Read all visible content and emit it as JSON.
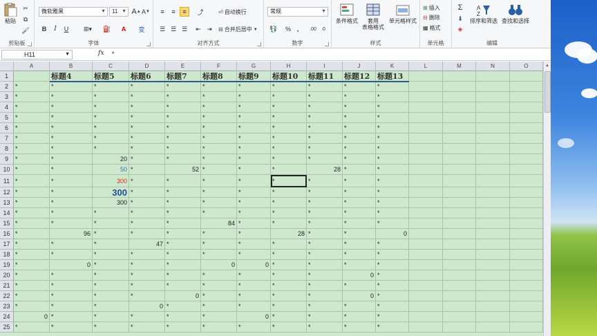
{
  "ribbon": {
    "clipboard": {
      "paste": "粘贴",
      "label": "剪贴板"
    },
    "font": {
      "name": "微软雅黑",
      "size": "11",
      "bold": "B",
      "italic": "I",
      "underline": "U",
      "wen": "变",
      "label": "字体",
      "grow": "A",
      "shrink": "A"
    },
    "alignment": {
      "wrap": "自动换行",
      "merge": "合并后居中",
      "label": "对齐方式"
    },
    "number": {
      "format": "常规",
      "percent": "%",
      "comma": ",",
      "label": "数字"
    },
    "styles": {
      "conditional": "条件格式",
      "table1": "套用",
      "table2": "表格格式",
      "cell_styles": "单元格样式",
      "label": "样式"
    },
    "cells": {
      "insert": "插入",
      "delete": "删除",
      "format": "格式",
      "label": "单元格"
    },
    "editing": {
      "sigma": "Σ",
      "sort": "排序和筛选",
      "find": "查找和选择",
      "label": "编辑"
    }
  },
  "formula_bar": {
    "name_box": "H11",
    "fx": "fx",
    "content": "*"
  },
  "columns": [
    "A",
    "B",
    "C",
    "D",
    "E",
    "F",
    "G",
    "H",
    "I",
    "J",
    "K",
    "L",
    "M",
    "N",
    "O"
  ],
  "rows": [
    {
      "n": "1",
      "cells": [
        "",
        "标题4",
        "标题5",
        "标题6",
        "标题7",
        "标题8",
        "标题9",
        "标题10",
        "标题11",
        "标题12",
        "标题13",
        "",
        "",
        "",
        ""
      ]
    },
    {
      "n": "2",
      "cells": [
        "*",
        "*",
        "*",
        "*",
        "*",
        "*",
        "*",
        "*",
        "*",
        "*",
        "*",
        "",
        "",
        "",
        ""
      ]
    },
    {
      "n": "3",
      "cells": [
        "*",
        "*",
        "*",
        "*",
        "*",
        "*",
        "*",
        "*",
        "*",
        "*",
        "*",
        "",
        "",
        "",
        ""
      ]
    },
    {
      "n": "4",
      "cells": [
        "*",
        "*",
        "*",
        "*",
        "*",
        "*",
        "*",
        "*",
        "*",
        "*",
        "*",
        "",
        "",
        "",
        ""
      ]
    },
    {
      "n": "5",
      "cells": [
        "*",
        "*",
        "*",
        "*",
        "*",
        "*",
        "*",
        "*",
        "*",
        "*",
        "*",
        "",
        "",
        "",
        ""
      ]
    },
    {
      "n": "6",
      "cells": [
        "*",
        "*",
        "*",
        "*",
        "*",
        "*",
        "*",
        "*",
        "*",
        "*",
        "*",
        "",
        "",
        "",
        ""
      ]
    },
    {
      "n": "7",
      "cells": [
        "*",
        "*",
        "*",
        "*",
        "*",
        "*",
        "*",
        "*",
        "*",
        "*",
        "*",
        "",
        "",
        "",
        ""
      ]
    },
    {
      "n": "8",
      "cells": [
        "*",
        "*",
        "*",
        "*",
        "*",
        "*",
        "*",
        "*",
        "*",
        "*",
        "*",
        "",
        "",
        "",
        ""
      ]
    },
    {
      "n": "9",
      "cells": [
        "*",
        "*",
        "20",
        "*",
        "*",
        "*",
        "*",
        "*",
        "*",
        "*",
        "*",
        "",
        "",
        "",
        ""
      ]
    },
    {
      "n": "10",
      "cells": [
        "*",
        "*",
        "50",
        "*",
        "52",
        "*",
        "*",
        "*",
        "28",
        "*",
        "*",
        "",
        "",
        "",
        ""
      ]
    },
    {
      "n": "11",
      "cells": [
        "*",
        "*",
        "300",
        "*",
        "*",
        "*",
        "*",
        "*",
        "*",
        "*",
        "*",
        "",
        "",
        "",
        ""
      ]
    },
    {
      "n": "12",
      "cells": [
        "*",
        "*",
        "300",
        "*",
        "*",
        "*",
        "*",
        "*",
        "*",
        "*",
        "*",
        "",
        "",
        "",
        ""
      ]
    },
    {
      "n": "13",
      "cells": [
        "*",
        "*",
        "300",
        "*",
        "*",
        "*",
        "*",
        "*",
        "*",
        "*",
        "*",
        "",
        "",
        "",
        ""
      ]
    },
    {
      "n": "14",
      "cells": [
        "*",
        "*",
        "*",
        "*",
        "*",
        "*",
        "*",
        "*",
        "*",
        "*",
        "*",
        "",
        "",
        "",
        ""
      ]
    },
    {
      "n": "15",
      "cells": [
        "*",
        "*",
        "*",
        "*",
        "*",
        "84",
        "*",
        "*",
        "*",
        "*",
        "*",
        "",
        "",
        "",
        ""
      ]
    },
    {
      "n": "16",
      "cells": [
        "*",
        "96",
        "*",
        "*",
        "*",
        "*",
        "*",
        "28",
        "*",
        "*",
        "0",
        "",
        "",
        "",
        ""
      ]
    },
    {
      "n": "17",
      "cells": [
        "*",
        "*",
        "*",
        "47",
        "*",
        "*",
        "*",
        "*",
        "*",
        "*",
        "*",
        "",
        "",
        "",
        ""
      ]
    },
    {
      "n": "18",
      "cells": [
        "*",
        "*",
        "*",
        "*",
        "*",
        "*",
        "*",
        "*",
        "*",
        "*",
        "*",
        "",
        "",
        "",
        ""
      ]
    },
    {
      "n": "19",
      "cells": [
        "*",
        "0",
        "*",
        "*",
        "*",
        "0",
        "0",
        "*",
        "*",
        "*",
        "*",
        "",
        "",
        "",
        ""
      ]
    },
    {
      "n": "20",
      "cells": [
        "*",
        "*",
        "*",
        "*",
        "*",
        "*",
        "*",
        "*",
        "*",
        "0",
        "*",
        "",
        "",
        "",
        ""
      ]
    },
    {
      "n": "21",
      "cells": [
        "*",
        "*",
        "*",
        "*",
        "*",
        "*",
        "*",
        "*",
        "*",
        "*",
        "*",
        "",
        "",
        "",
        ""
      ]
    },
    {
      "n": "22",
      "cells": [
        "*",
        "*",
        "*",
        "*",
        "0",
        "*",
        "*",
        "*",
        "*",
        "0",
        "*",
        "",
        "",
        "",
        ""
      ]
    },
    {
      "n": "23",
      "cells": [
        "*",
        "*",
        "*",
        "0",
        "*",
        "*",
        "*",
        "*",
        "*",
        "*",
        "*",
        "",
        "",
        "",
        ""
      ]
    },
    {
      "n": "24",
      "cells": [
        "0",
        "*",
        "*",
        "*",
        "*",
        "*",
        "0",
        "*",
        "*",
        "*",
        "*",
        "",
        "",
        "",
        ""
      ]
    },
    {
      "n": "25",
      "cells": [
        "*",
        "*",
        "*",
        "*",
        "*",
        "*",
        "*",
        "*",
        "*",
        "*",
        "*",
        "",
        "",
        "",
        ""
      ]
    }
  ],
  "styled_cells": {
    "9-2": "bl",
    "10-2": "rd",
    "11-2": "big300"
  }
}
